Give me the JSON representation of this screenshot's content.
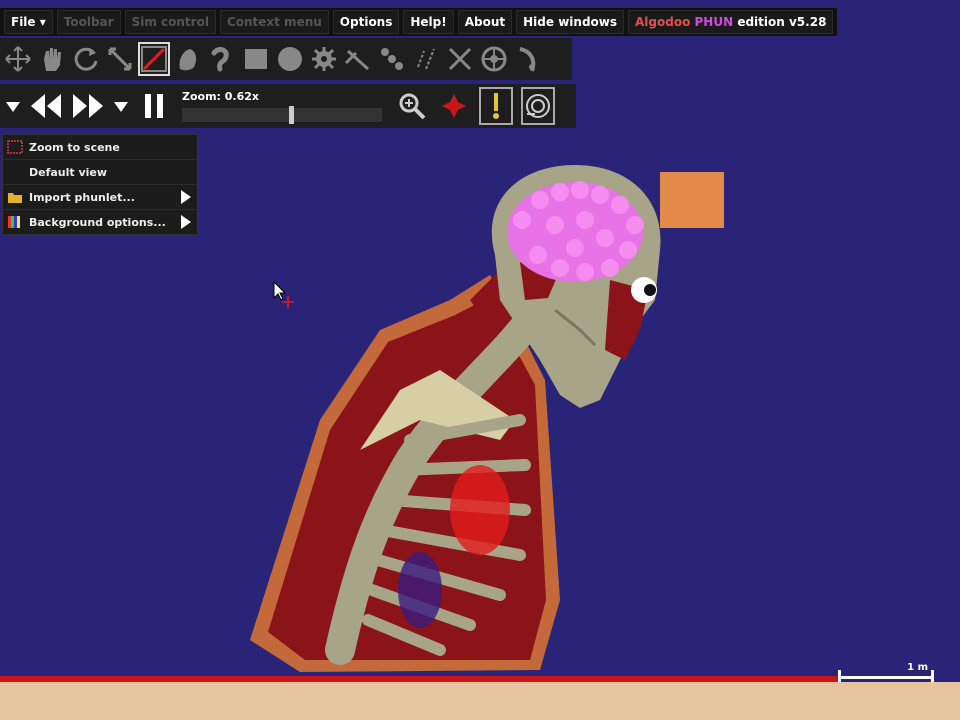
{
  "menubar": {
    "items": [
      {
        "label": "File ▾",
        "enabled": true
      },
      {
        "label": "Toolbar",
        "enabled": false
      },
      {
        "label": "Sim control",
        "enabled": false
      },
      {
        "label": "Context menu",
        "enabled": false
      },
      {
        "label": "Options",
        "enabled": true
      },
      {
        "label": "Help!",
        "enabled": true
      },
      {
        "label": "About",
        "enabled": true
      },
      {
        "label": "Hide windows",
        "enabled": true
      }
    ],
    "edition_brand_a": "Algodoo",
    "edition_brand_b": "PHUN",
    "edition_suffix": "edition v5.28"
  },
  "toolbar": {
    "tools": [
      "move-icon",
      "drag-hand-icon",
      "rotate-icon",
      "scale-icon",
      "sketch-icon",
      "brush-icon",
      "chain-icon",
      "box-icon",
      "circle-icon",
      "gear-icon",
      "plane-icon",
      "hinge-chain-icon",
      "laser-pen-icon",
      "knife-icon",
      "fixate-icon",
      "wheel-icon",
      "spring-icon"
    ],
    "selected": "sketch-icon"
  },
  "sim": {
    "zoom_label": "Zoom: 0.62x",
    "zoom_fraction": 0.55
  },
  "context_menu": {
    "items": [
      {
        "label": "Zoom to scene",
        "icon": "zoom-scene-icon",
        "submenu": false
      },
      {
        "label": "Default view",
        "icon": "",
        "submenu": false
      },
      {
        "label": "Import phunlet...",
        "icon": "folder-icon",
        "submenu": true
      },
      {
        "label": "Background options...",
        "icon": "palette-icon",
        "submenu": true
      }
    ]
  },
  "scene": {
    "scale_label": "1 m",
    "colors": {
      "background": "#2a2478",
      "ground": "#e6c4a0",
      "skin": "#c46a3a",
      "flesh": "#8a1418",
      "bone": "#a8a487",
      "brain": "#e873e6",
      "box": "#e28a48"
    }
  }
}
